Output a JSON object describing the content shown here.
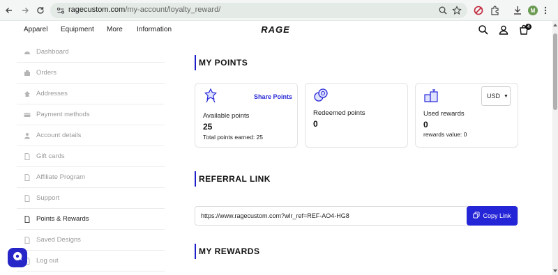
{
  "browser": {
    "url_host": "ragecustom.com",
    "url_path": "/my-account/loyalty_reward/",
    "profile_initial": "M",
    "icons": [
      "back-arrow-icon",
      "forward-arrow-icon",
      "reload-icon",
      "site-info-icon",
      "zoom-icon",
      "bookmark-star-icon",
      "extension-icon",
      "puzzle-icon",
      "download-icon"
    ]
  },
  "header": {
    "nav": [
      "Apparel",
      "Equipment",
      "More",
      "Information"
    ],
    "logo_text": "RAGE",
    "cart_count": "4"
  },
  "sidebar": {
    "items": [
      {
        "label": "Dashboard",
        "icon": "dashboard-icon",
        "active": false
      },
      {
        "label": "Orders",
        "icon": "orders-icon",
        "active": false
      },
      {
        "label": "Addresses",
        "icon": "home-icon",
        "active": false
      },
      {
        "label": "Payment methods",
        "icon": "credit-card-icon",
        "active": false
      },
      {
        "label": "Account details",
        "icon": "user-icon",
        "active": false
      },
      {
        "label": "Gift cards",
        "icon": "document-icon",
        "active": false
      },
      {
        "label": "Affiliate Program",
        "icon": "document-icon",
        "active": false
      },
      {
        "label": "Support",
        "icon": "document-icon",
        "active": false
      },
      {
        "label": "Points & Rewards",
        "icon": "document-icon",
        "active": true
      },
      {
        "label": "Saved Designs",
        "icon": "document-icon",
        "active": false
      },
      {
        "label": "Log out",
        "icon": "logout-icon",
        "active": false
      }
    ]
  },
  "main": {
    "my_points_title": "MY POINTS",
    "card_available": {
      "share_label": "Share Points",
      "label": "Available points",
      "value": "25",
      "sub": "Total points earned: 25"
    },
    "card_redeemed": {
      "label": "Redeemed points",
      "value": "0"
    },
    "card_used": {
      "label": "Used rewards",
      "value": "0",
      "sub": "rewards value: 0",
      "currency": "USD"
    },
    "referral_title": "REFERRAL LINK",
    "referral_url": "https://www.ragecustom.com?wlr_ref=REF-AO4-HG8",
    "copy_label": "Copy Link",
    "rewards_title": "MY REWARDS"
  },
  "colors": {
    "accent": "#2525d8",
    "muted_text": "#9a9a9a"
  }
}
